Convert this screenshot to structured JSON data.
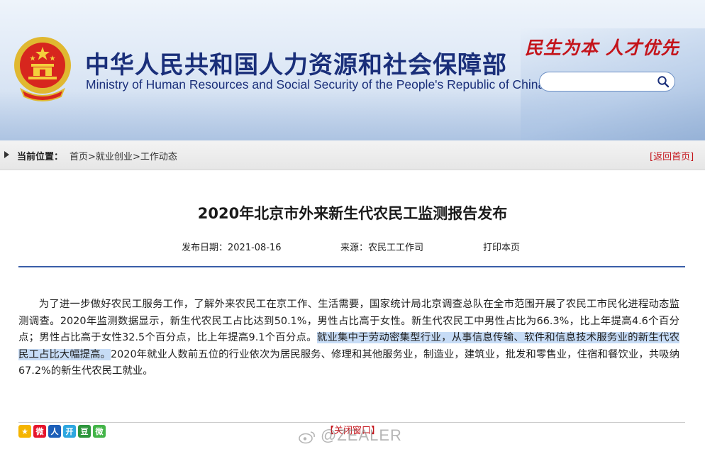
{
  "header": {
    "title_cn": "中华人民共和国人力资源和社会保障部",
    "title_en": "Ministry of Human Resources and Social Security of the People's Republic of China",
    "slogan": "民生为本 人才优先",
    "search": {
      "value": "",
      "placeholder": ""
    }
  },
  "breadcrumb": {
    "label": "当前位置：",
    "items": [
      "首页",
      "就业创业",
      "工作动态"
    ],
    "separator": ">",
    "back_home": "[返回首页]"
  },
  "article": {
    "title": "2020年北京市外来新生代农民工监测报告发布",
    "date_label": "发布日期：",
    "date": "2021-08-16",
    "source_label": "来源：",
    "source": "农民工工作司",
    "print": "打印本页",
    "body_before": "为了进一步做好农民工服务工作，了解外来农民工在京工作、生活需要，国家统计局北京调查总队在全市范围开展了农民工市民化进程动态监测调查。2020年监测数据显示，新生代农民工占比达到50.1%，男性占比高于女性。新生代农民工中男性占比为66.3%，比上年提高4.6个百分点；男性占比高于女性32.5个百分点，比上年提高9.1个百分点。",
    "body_highlight": "就业集中于劳动密集型行业，从事信息传输、软件和信息技术服务业的新生代农民工占比大幅提高。",
    "body_after": "2020年就业人数前五位的行业依次为居民服务、修理和其他服务业，制造业，建筑业，批发和零售业，住宿和餐饮业，共吸纳67.2%的新生代农民工就业。"
  },
  "footer": {
    "close_window": "【关闭窗口】",
    "watermark": "@ZEALER",
    "share_icons": [
      {
        "name": "qzone-icon",
        "glyph": "★",
        "color": "#f5b400"
      },
      {
        "name": "weibo-icon",
        "glyph": "微",
        "color": "#e6162d"
      },
      {
        "name": "renren-icon",
        "glyph": "人",
        "color": "#1d5fb8"
      },
      {
        "name": "kaixin-icon",
        "glyph": "开",
        "color": "#2ea7e0"
      },
      {
        "name": "douban-icon",
        "glyph": "豆",
        "color": "#2e963d"
      },
      {
        "name": "wechat-icon",
        "glyph": "微",
        "color": "#44b549"
      }
    ]
  },
  "colors": {
    "brand_blue": "#1a2f7a",
    "accent_red": "#c4141b",
    "highlight": "#c7dcf6"
  }
}
